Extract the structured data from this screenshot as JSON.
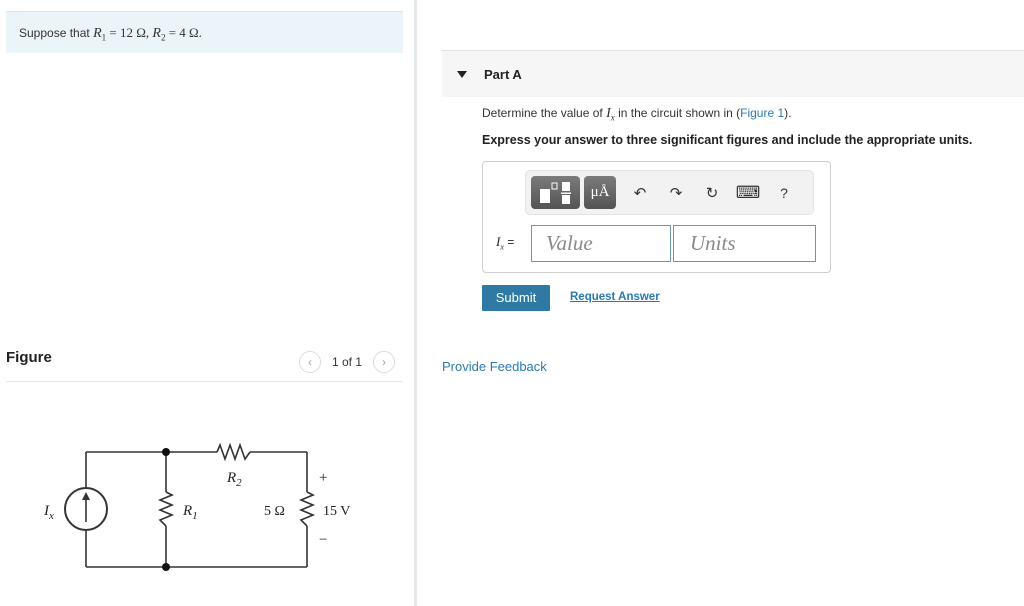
{
  "intro": {
    "prefix": "Suppose that ",
    "r1_symbol": "R",
    "r1_sub": "1",
    "r1_value": " = 12 Ω, ",
    "r2_symbol": "R",
    "r2_sub": "2",
    "r2_value": " = 4 Ω."
  },
  "figure_panel": {
    "title": "Figure",
    "prev_icon": "‹",
    "next_icon": "›",
    "counter": "1 of 1"
  },
  "circuit": {
    "source_label": "I",
    "source_sub": "x",
    "r1_label": "R",
    "r1_sub": "1",
    "r2_label": "R",
    "r2_sub": "2",
    "load_resistance": "5 Ω",
    "load_voltage": "15 V",
    "plus": "+",
    "minus": "−"
  },
  "part": {
    "title": "Part A",
    "question_prefix": "Determine the value of ",
    "question_var": "I",
    "question_var_sub": "x",
    "question_mid": " in the circuit shown in (",
    "figure_link": "Figure 1",
    "question_suffix": ").",
    "instruction": "Express your answer to three significant figures and include the appropriate units."
  },
  "answer": {
    "toolbar": {
      "units_label": "μÅ",
      "undo_icon": "↶",
      "redo_icon": "↷",
      "reset_icon": "↻",
      "keyboard_icon": "⌨",
      "help_label": "?"
    },
    "eq_var": "I",
    "eq_sub": "x",
    "eq_sign": " =",
    "value_placeholder": "Value",
    "units_placeholder": "Units"
  },
  "actions": {
    "submit": "Submit",
    "request_answer": "Request Answer",
    "provide_feedback": "Provide Feedback"
  }
}
